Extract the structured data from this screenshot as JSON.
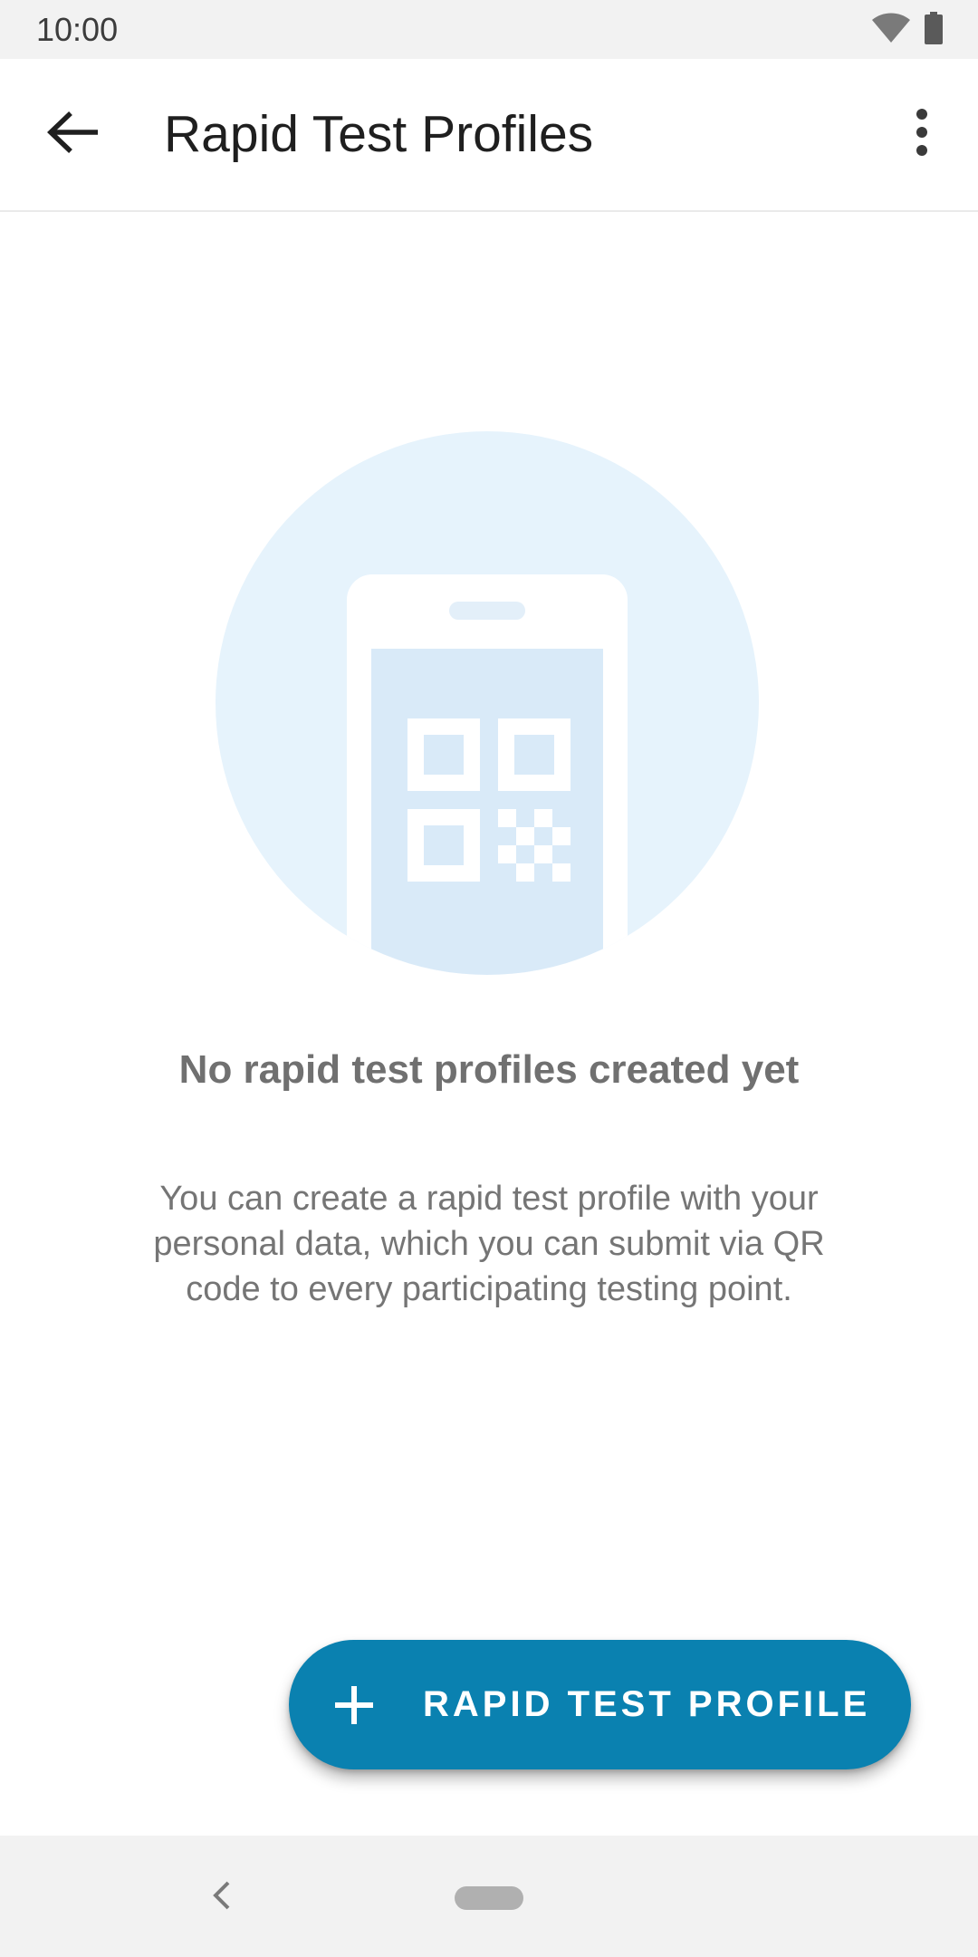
{
  "status_bar": {
    "time": "10:00",
    "icons": [
      "wifi-icon",
      "battery-icon"
    ]
  },
  "app_bar": {
    "title": "Rapid Test Profiles",
    "back_icon": "arrow-back-icon",
    "menu_icon": "more-vert-icon"
  },
  "empty_state": {
    "illustration": "phone-qr-code-illustration",
    "title": "No rapid test profiles created yet",
    "description": "You can create a rapid test profile with your personal data, which you can submit via QR code to every participating testing point."
  },
  "fab": {
    "icon": "plus-icon",
    "label": "RAPID TEST PROFILE"
  },
  "nav_bar": {
    "back_icon": "nav-back-icon",
    "home_icon": "nav-home-pill"
  },
  "colors": {
    "accent": "#0a81b0",
    "illustration_circle": "#e6f3fc",
    "illustration_screen": "#d9eaf8",
    "text_secondary": "#757575"
  }
}
